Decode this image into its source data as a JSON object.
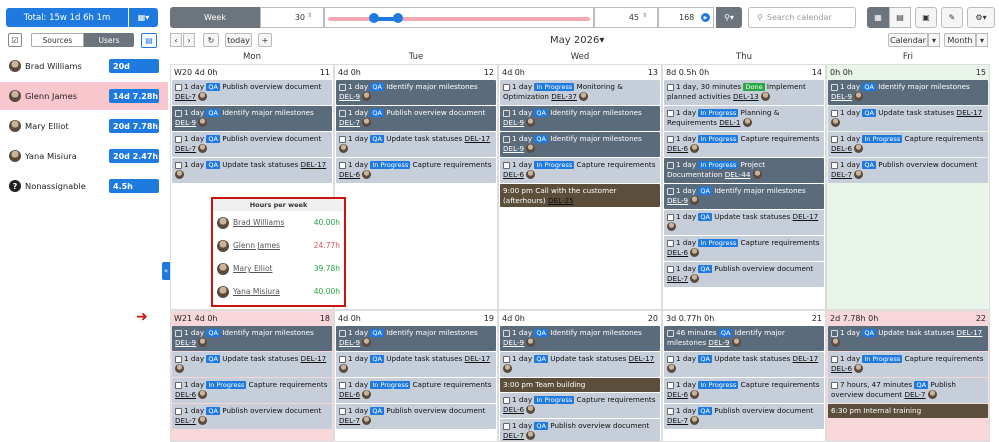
{
  "left": {
    "total_label": "Total: 15w 1d 6h 1m",
    "tabs": [
      "Sources",
      "Users"
    ],
    "people": [
      {
        "name": "Brad Williams",
        "badge": "20d",
        "highlight": false
      },
      {
        "name": "Glenn James",
        "badge": "14d 7.28h",
        "highlight": true
      },
      {
        "name": "Mary Elliot",
        "badge": "20d 7.78h",
        "highlight": false
      },
      {
        "name": "Yana Misiura",
        "badge": "20d 2.47h",
        "highlight": false
      },
      {
        "name": "Nonassignable",
        "badge": "4.5h",
        "highlight": false
      }
    ]
  },
  "toolbar": {
    "week_label": "Week",
    "value1": "30",
    "value2": "45",
    "value3": "168",
    "search_placeholder": "Search calendar",
    "today_label": "today",
    "month_title": "May 2026",
    "calendar_label": "Calendar",
    "month_label": "Month",
    "add_label": "+"
  },
  "days": [
    "Mon",
    "Tue",
    "Wed",
    "Thu",
    "Fri"
  ],
  "weeks": [
    {
      "cells": [
        {
          "head_left": "W20 4d 0h",
          "day": "11",
          "events": [
            {
              "style": "gray",
              "text": "1 day",
              "tag": "QA",
              "title": "Publish overview document",
              "ref": "DEL-7"
            },
            {
              "style": "dark",
              "text": "1 day",
              "tag": "QA",
              "title": "Identify major milestones",
              "ref": "DEL-9"
            },
            {
              "style": "gray",
              "text": "1 day",
              "tag": "QA",
              "title": "Publish overview document",
              "ref": "DEL-7"
            },
            {
              "style": "gray",
              "text": "1 day",
              "tag": "QA",
              "title": "Update task statuses",
              "ref": "DEL-17"
            }
          ]
        },
        {
          "head_left": "4d 0h",
          "day": "12",
          "events": [
            {
              "style": "dark",
              "text": "1 day",
              "tag": "QA",
              "title": "Identify major milestones",
              "ref": "DEL-9"
            },
            {
              "style": "dark",
              "text": "1 day",
              "tag": "QA",
              "title": "Publish overview document",
              "ref": "DEL-7"
            },
            {
              "style": "gray",
              "text": "1 day",
              "tag": "QA",
              "title": "Update task statuses",
              "ref": "DEL-17"
            },
            {
              "style": "gray",
              "text": "1 day",
              "tag": "In Progress",
              "title": "Capture requirements",
              "ref": "DEL-6"
            }
          ]
        },
        {
          "head_left": "4d 0h",
          "day": "13",
          "events": [
            {
              "style": "gray",
              "text": "1 day",
              "tag": "In Progress",
              "title": "Monitoring & Optimization",
              "ref": "DEL-37"
            },
            {
              "style": "dark",
              "text": "1 day",
              "tag": "QA",
              "title": "Identify major milestones",
              "ref": "DEL-9"
            },
            {
              "style": "dark",
              "text": "1 day",
              "tag": "QA",
              "title": "Identify major milestones",
              "ref": "DEL-9"
            },
            {
              "style": "gray",
              "text": "1 day",
              "tag": "In Progress",
              "title": "Capture requirements",
              "ref": "DEL-6"
            },
            {
              "style": "brown",
              "text": "9:00 pm",
              "tag": "",
              "title": "Call with the customer (afterhours)",
              "ref": "DEL-25"
            }
          ]
        },
        {
          "head_left": "8d 0.5h 0h",
          "day": "14",
          "events": [
            {
              "style": "gray",
              "text": "1 day, 30 minutes",
              "tag": "Done",
              "title": "Implement planned activities",
              "ref": "DEL-13"
            },
            {
              "style": "gray",
              "text": "1 day",
              "tag": "In Progress",
              "title": "Planning & Requirements",
              "ref": "DEL-1"
            },
            {
              "style": "gray",
              "text": "1 day",
              "tag": "In Progress",
              "title": "Capture requirements",
              "ref": "DEL-6"
            },
            {
              "style": "dark",
              "text": "1 day",
              "tag": "In Progress",
              "title": "Project Documentation",
              "ref": "DEL-44"
            },
            {
              "style": "dark",
              "text": "1 day",
              "tag": "QA",
              "title": "Identify major milestones",
              "ref": "DEL-9"
            },
            {
              "style": "gray",
              "text": "1 day",
              "tag": "QA",
              "title": "Update task statuses",
              "ref": "DEL-17"
            },
            {
              "style": "gray",
              "text": "1 day",
              "tag": "In Progress",
              "title": "Capture requirements",
              "ref": "DEL-6"
            },
            {
              "style": "gray",
              "text": "1 day",
              "tag": "QA",
              "title": "Publish overview document",
              "ref": "DEL-7"
            }
          ]
        },
        {
          "head_left": "0h 0h",
          "day": "15",
          "events": [
            {
              "style": "dark",
              "text": "1 day",
              "tag": "QA",
              "title": "Identify major milestones",
              "ref": "DEL-9"
            },
            {
              "style": "gray",
              "text": "1 day",
              "tag": "QA",
              "title": "Update task statuses",
              "ref": "DEL-17"
            },
            {
              "style": "gray",
              "text": "1 day",
              "tag": "In Progress",
              "title": "Capture requirements",
              "ref": "DEL-6"
            },
            {
              "style": "gray",
              "text": "1 day",
              "tag": "QA",
              "title": "Publish overview document",
              "ref": "DEL-7"
            }
          ]
        }
      ]
    },
    {
      "cells": [
        {
          "head_left": "W21 4d 0h",
          "day": "18",
          "events": [
            {
              "style": "dark",
              "text": "1 day",
              "tag": "QA",
              "title": "Identify major milestones",
              "ref": "DEL-9"
            },
            {
              "style": "gray",
              "text": "1 day",
              "tag": "QA",
              "title": "Update task statuses",
              "ref": "DEL-17"
            },
            {
              "style": "gray",
              "text": "1 day",
              "tag": "In Progress",
              "title": "Capture requirements",
              "ref": "DEL-6"
            },
            {
              "style": "gray",
              "text": "1 day",
              "tag": "QA",
              "title": "Publish overview document",
              "ref": "DEL-7"
            }
          ]
        },
        {
          "head_left": "4d 0h",
          "day": "19",
          "events": [
            {
              "style": "dark",
              "text": "1 day",
              "tag": "QA",
              "title": "Identify major milestones",
              "ref": "DEL-9"
            },
            {
              "style": "gray",
              "text": "1 day",
              "tag": "QA",
              "title": "Update task statuses",
              "ref": "DEL-17"
            },
            {
              "style": "gray",
              "text": "1 day",
              "tag": "In Progress",
              "title": "Capture requirements",
              "ref": "DEL-6"
            },
            {
              "style": "gray",
              "text": "1 day",
              "tag": "QA",
              "title": "Publish overview document",
              "ref": "DEL-7"
            }
          ]
        },
        {
          "head_left": "4d 0h",
          "day": "20",
          "events": [
            {
              "style": "dark",
              "text": "1 day",
              "tag": "QA",
              "title": "Identify major milestones",
              "ref": "DEL-9"
            },
            {
              "style": "gray",
              "text": "1 day",
              "tag": "QA",
              "title": "Update task statuses",
              "ref": "DEL-17"
            },
            {
              "style": "brown",
              "text": "3:00 pm",
              "tag": "",
              "title": "Team building",
              "ref": ""
            },
            {
              "style": "gray",
              "text": "1 day",
              "tag": "In Progress",
              "title": "Capture requirements",
              "ref": "DEL-6"
            },
            {
              "style": "gray",
              "text": "1 day",
              "tag": "QA",
              "title": "Publish overview document",
              "ref": "DEL-7"
            }
          ]
        },
        {
          "head_left": "3d 0.77h 0h",
          "day": "21",
          "events": [
            {
              "style": "dark",
              "text": "46 minutes",
              "tag": "QA",
              "title": "Identify major milestones",
              "ref": "DEL-9"
            },
            {
              "style": "gray",
              "text": "1 day",
              "tag": "QA",
              "title": "Update task statuses",
              "ref": "DEL-17"
            },
            {
              "style": "gray",
              "text": "1 day",
              "tag": "In Progress",
              "title": "Capture requirements",
              "ref": "DEL-6"
            },
            {
              "style": "gray",
              "text": "1 day",
              "tag": "QA",
              "title": "Publish overview document",
              "ref": "DEL-7"
            }
          ]
        },
        {
          "head_left": "2d 7.78h 0h",
          "day": "22",
          "events": [
            {
              "style": "dark",
              "text": "1 day",
              "tag": "QA",
              "title": "Update task statuses",
              "ref": "DEL-17"
            },
            {
              "style": "gray",
              "text": "1 day",
              "tag": "In Progress",
              "title": "Capture requirements",
              "ref": "DEL-6"
            },
            {
              "style": "gray",
              "text": "7 hours, 47 minutes",
              "tag": "QA",
              "title": "Publish overview document",
              "ref": "DEL-7"
            },
            {
              "style": "brown",
              "text": "6:30 pm",
              "tag": "",
              "title": "Internal training",
              "ref": ""
            }
          ]
        }
      ]
    }
  ],
  "hours_per_week": {
    "title": "Hours per week",
    "rows": [
      {
        "name": "Brad Williams",
        "hours": "40.00h",
        "color": "#28a745"
      },
      {
        "name": "Glenn James",
        "hours": "24.77h",
        "color": "#d9534f"
      },
      {
        "name": "Mary Elliot",
        "hours": "39.78h",
        "color": "#28a745"
      },
      {
        "name": "Yana Misiura",
        "hours": "40.00h",
        "color": "#28a745"
      }
    ]
  },
  "colors": {
    "primary": "#1f7ae0",
    "highlight_row": "#f8c6cc",
    "today_bg": "#eaf5ea"
  }
}
